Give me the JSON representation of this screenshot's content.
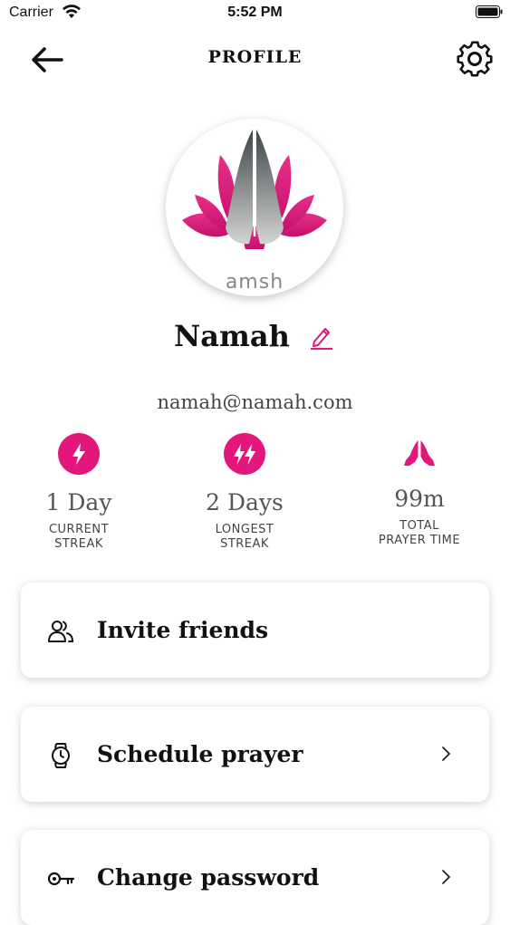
{
  "status_bar": {
    "carrier": "Carrier",
    "time": "5:52 PM",
    "wifi_icon": "wifi-icon",
    "battery_icon": "battery-icon"
  },
  "header": {
    "title": "PROFILE",
    "back_icon": "back-arrow-icon",
    "settings_icon": "gear-icon"
  },
  "profile": {
    "avatar_caption": "amsh",
    "name": "Namah",
    "email": "namah@namah.com",
    "edit_icon": "pencil-icon"
  },
  "stats": [
    {
      "value": "1 Day",
      "label_line1": "CURRENT",
      "label_line2": "STREAK",
      "icon": "lightning-icon"
    },
    {
      "value": "2 Days",
      "label_line1": "LONGEST",
      "label_line2": "STREAK",
      "icon": "double-lightning-icon"
    },
    {
      "value": "99m",
      "label_line1": "TOTAL",
      "label_line2": "PRAYER TIME",
      "icon": "praying-hands-icon"
    }
  ],
  "menu": [
    {
      "label": "Invite friends",
      "icon": "users-icon"
    },
    {
      "label": "Schedule prayer",
      "icon": "watch-icon"
    },
    {
      "label": "Change password",
      "icon": "key-icon"
    }
  ],
  "colors": {
    "accent": "#e3177b",
    "text": "#111111",
    "muted": "#555555"
  }
}
